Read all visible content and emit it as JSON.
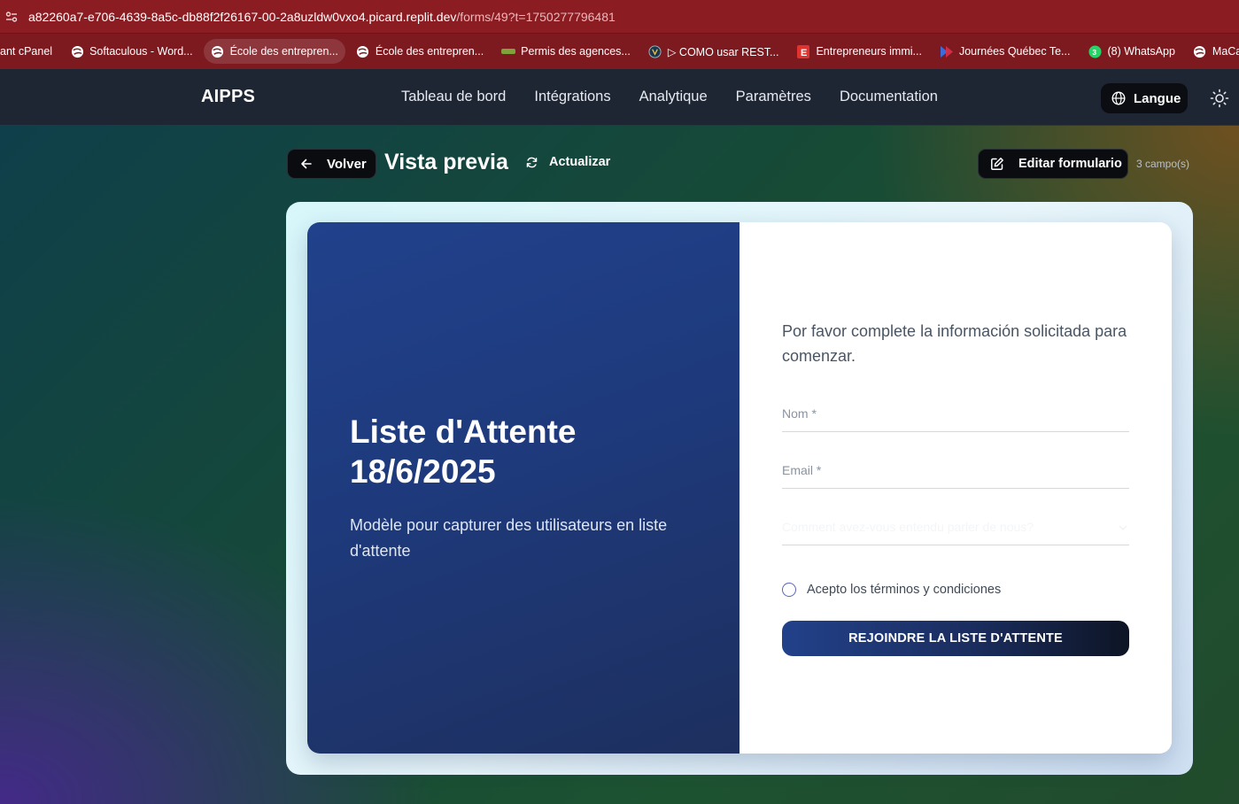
{
  "browser": {
    "url_host": "a82260a7-e706-4639-8a5c-db88f2f26167-00-2a8uzldw0vxo4.picard.replit.dev",
    "url_path": "/forms/49?t=1750277796481",
    "bookmarks": [
      {
        "label": "ant cPanel",
        "icon": "none"
      },
      {
        "label": "Softaculous - Word...",
        "icon": "globe-icon"
      },
      {
        "label": "École des entrepren...",
        "icon": "globe-icon"
      },
      {
        "label": "École des entrepren...",
        "icon": "globe-icon"
      },
      {
        "label": "Permis des agences...",
        "icon": "leaf-icon"
      },
      {
        "label": "▷ COMO usar REST...",
        "icon": "circle-logo-icon"
      },
      {
        "label": "Entrepreneurs immi...",
        "icon": "e-icon"
      },
      {
        "label": "Journées Québec Te...",
        "icon": "arrow-logo-icon"
      },
      {
        "label": "(8) WhatsApp",
        "icon": "whatsapp-icon"
      },
      {
        "label": "MaCarrièreTECHNO...",
        "icon": "globe-icon"
      }
    ]
  },
  "appnav": {
    "logo": "AIPPS",
    "links": [
      "Tableau de bord",
      "Intégrations",
      "Analytique",
      "Paramètres",
      "Documentation"
    ],
    "language_button": "Langue"
  },
  "toolbar": {
    "back_label": "Volver",
    "title": "Vista previa",
    "refresh_label": "Actualizar",
    "edit_label": "Editar formulario",
    "field_count": "3 campo(s)"
  },
  "form": {
    "title": "Liste d'Attente 18/6/2025",
    "description": "Modèle pour capturer des utilisateurs en liste d'attente",
    "intro": "Por favor complete la información solicitada para comenzar.",
    "fields": [
      {
        "label": "Nom *"
      },
      {
        "label": "Email *"
      },
      {
        "label": "Comment avez-vous entendu parler de nous?"
      }
    ],
    "terms_label": "Acepto los términos y condiciones",
    "submit_label": "REJOINDRE LA LISTE D'ATTENTE"
  },
  "colors": {
    "addressbar": "#8b1c22",
    "bookmarks_bar": "#7d1a1f",
    "appnav": "#1e2533",
    "card_left": "#21418c",
    "submit": "#22418a"
  }
}
